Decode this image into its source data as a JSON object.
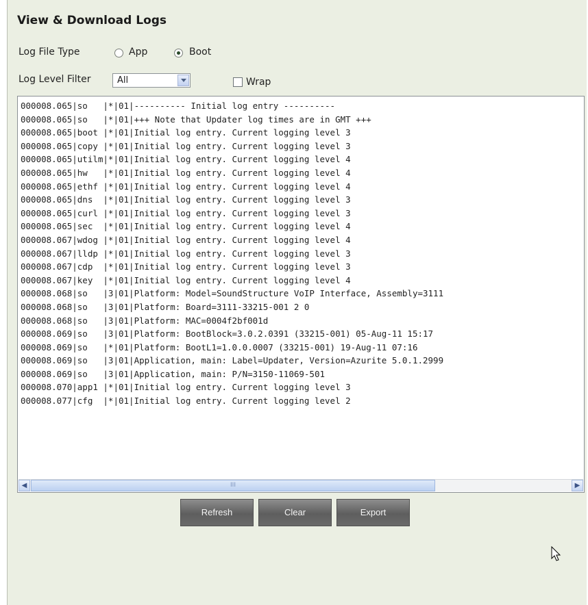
{
  "title": "View & Download Logs",
  "log_file_type": {
    "label": "Log File Type",
    "options": [
      {
        "label": "App",
        "selected": false
      },
      {
        "label": "Boot",
        "selected": true
      }
    ]
  },
  "log_level_filter": {
    "label": "Log Level Filter",
    "value": "All"
  },
  "wrap": {
    "label": "Wrap",
    "checked": false
  },
  "log_lines": [
    "000008.065|so   |*|01|---------- Initial log entry ----------",
    "000008.065|so   |*|01|+++ Note that Updater log times are in GMT +++",
    "000008.065|boot |*|01|Initial log entry. Current logging level 3",
    "000008.065|copy |*|01|Initial log entry. Current logging level 3",
    "000008.065|utilm|*|01|Initial log entry. Current logging level 4",
    "000008.065|hw   |*|01|Initial log entry. Current logging level 4",
    "000008.065|ethf |*|01|Initial log entry. Current logging level 4",
    "000008.065|dns  |*|01|Initial log entry. Current logging level 3",
    "000008.065|curl |*|01|Initial log entry. Current logging level 3",
    "000008.065|sec  |*|01|Initial log entry. Current logging level 4",
    "000008.067|wdog |*|01|Initial log entry. Current logging level 4",
    "000008.067|lldp |*|01|Initial log entry. Current logging level 3",
    "000008.067|cdp  |*|01|Initial log entry. Current logging level 3",
    "000008.067|key  |*|01|Initial log entry. Current logging level 4",
    "000008.068|so   |3|01|Platform: Model=SoundStructure VoIP Interface, Assembly=3111",
    "000008.068|so   |3|01|Platform: Board=3111-33215-001 2 0",
    "000008.068|so   |3|01|Platform: MAC=0004f2bf001d",
    "000008.069|so   |3|01|Platform: BootBlock=3.0.2.0391 (33215-001) 05-Aug-11 15:17",
    "000008.069|so   |*|01|Platform: BootL1=1.0.0.0007 (33215-001) 19-Aug-11 07:16",
    "000008.069|so   |3|01|Application, main: Label=Updater, Version=Azurite 5.0.1.2999",
    "000008.069|so   |3|01|Application, main: P/N=3150-11069-501",
    "000008.070|app1 |*|01|Initial log entry. Current logging level 3",
    "000008.077|cfg  |*|01|Initial log entry. Current logging level 2"
  ],
  "buttons": {
    "refresh": "Refresh",
    "clear": "Clear",
    "export": "Export"
  },
  "scrollbar": {
    "grip": "III"
  },
  "icons": {
    "scroll_left": "scroll-left-arrow-icon",
    "scroll_right": "scroll-right-arrow-icon",
    "dropdown": "chevron-down-icon",
    "cursor": "mouse-pointer-icon"
  }
}
